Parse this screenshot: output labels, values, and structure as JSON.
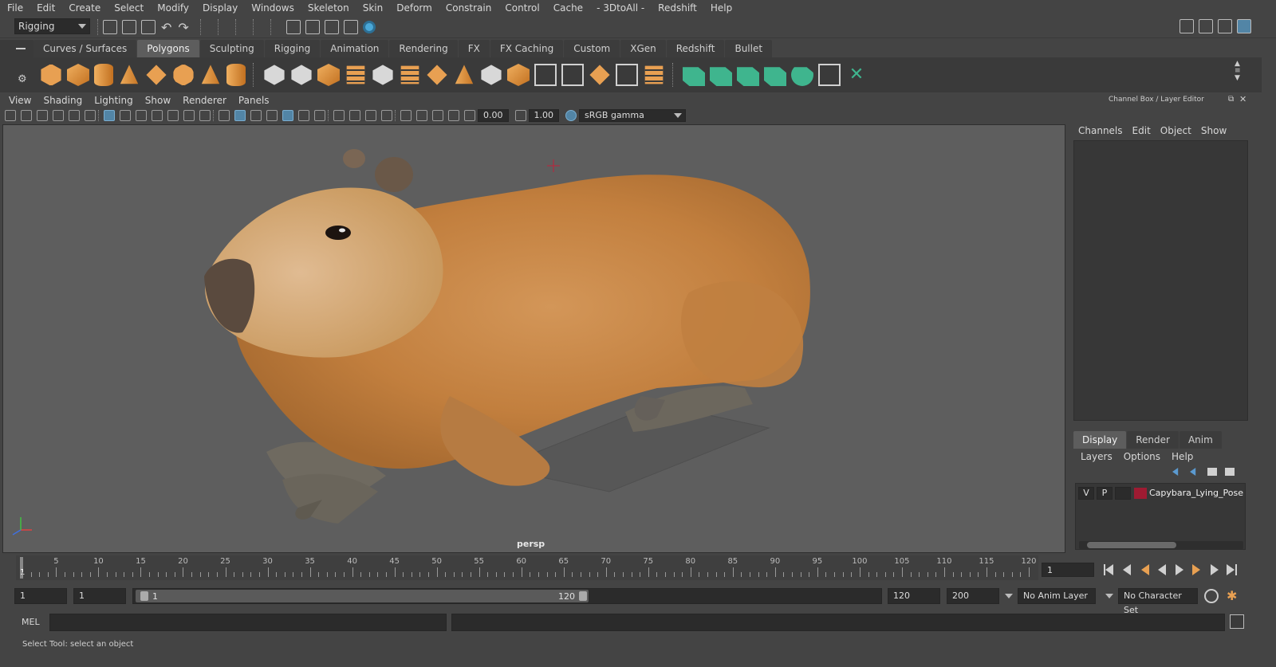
{
  "menu": [
    "File",
    "Edit",
    "Create",
    "Select",
    "Modify",
    "Display",
    "Windows",
    "Skeleton",
    "Skin",
    "Deform",
    "Constrain",
    "Control",
    "Cache",
    "- 3DtoAll -",
    "Redshift",
    "Help"
  ],
  "status_line": {
    "mode": "Rigging"
  },
  "shelf": {
    "tabs": [
      "Curves / Surfaces",
      "Polygons",
      "Sculpting",
      "Rigging",
      "Animation",
      "Rendering",
      "FX",
      "FX Caching",
      "Custom",
      "XGen",
      "Redshift",
      "Bullet"
    ],
    "active_tab": "Polygons"
  },
  "viewport": {
    "menus": [
      "View",
      "Shading",
      "Lighting",
      "Show",
      "Renderer",
      "Panels"
    ],
    "exposure": "0.00",
    "gamma": "1.00",
    "color_space": "sRGB gamma",
    "camera_label": "persp"
  },
  "channel_box": {
    "title": "Channel Box / Layer Editor",
    "menus": [
      "Channels",
      "Edit",
      "Object",
      "Show"
    ]
  },
  "layer_editor": {
    "tabs": [
      "Display",
      "Render",
      "Anim"
    ],
    "active_tab": "Display",
    "menus": [
      "Layers",
      "Options",
      "Help"
    ],
    "layers": [
      {
        "visible": "V",
        "playback": "P",
        "color": "#9e1b32",
        "name": "Capybara_Lying_Pose"
      }
    ]
  },
  "time_slider": {
    "labels": [
      "5",
      "10",
      "15",
      "20",
      "25",
      "30",
      "35",
      "40",
      "45",
      "50",
      "55",
      "60",
      "65",
      "70",
      "75",
      "80",
      "85",
      "90",
      "95",
      "100",
      "105",
      "110",
      "115",
      "120"
    ],
    "current_frame_marker": "1",
    "current_frame": "1"
  },
  "range_slider": {
    "start_time": "1",
    "playback_start": "1",
    "range_start_label": "1",
    "range_end_label": "120",
    "playback_end": "120",
    "end_time": "200",
    "anim_layer": "No Anim Layer",
    "character_set": "No Character Set"
  },
  "command_line": {
    "label": "MEL"
  },
  "help_line": "Select Tool: select an object"
}
